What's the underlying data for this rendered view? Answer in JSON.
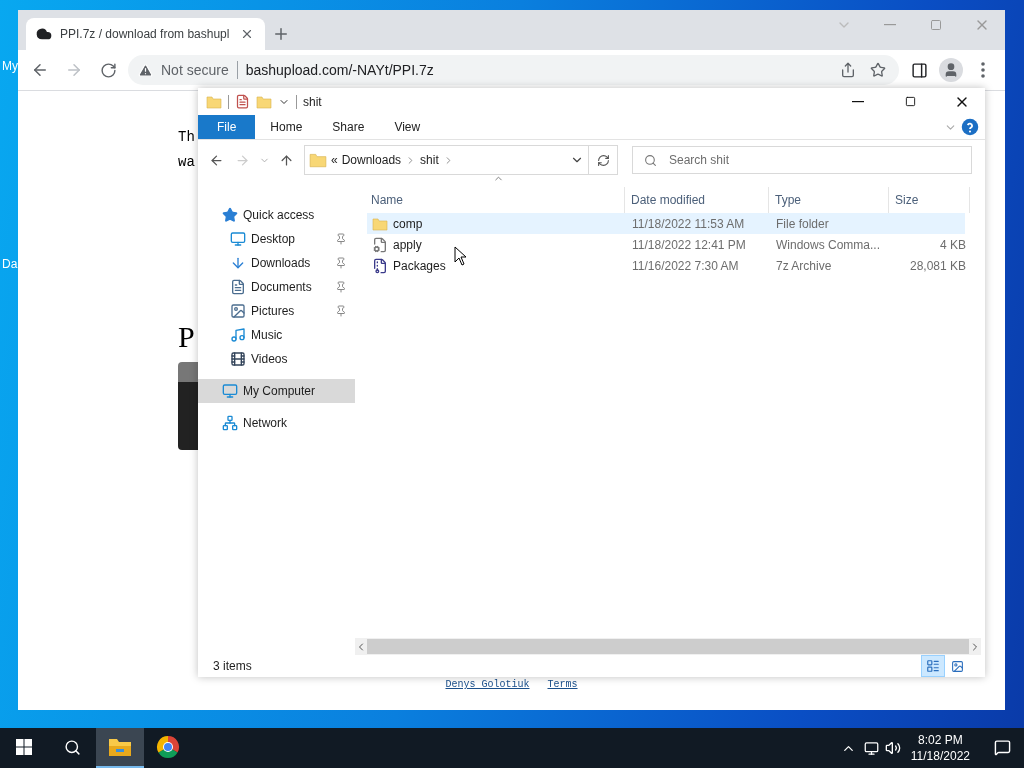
{
  "desktop": {
    "icon_labels": [
      "My",
      "Da"
    ]
  },
  "browser": {
    "tab": {
      "title": "PPI.7z / download from bashupl",
      "selected": true
    },
    "address": {
      "security": "Not secure",
      "url": "bashupload.com/-NAYt/PPI.7z"
    },
    "page": {
      "lines": [
        "Th",
        "wa"
      ],
      "heading": "P",
      "footer_links": [
        "Denys Golotiuk",
        "Terms"
      ]
    }
  },
  "explorer": {
    "title": "shit",
    "ribbon_tabs": [
      {
        "label": "File",
        "selected": true
      },
      {
        "label": "Home",
        "selected": false
      },
      {
        "label": "Share",
        "selected": false
      },
      {
        "label": "View",
        "selected": false
      }
    ],
    "breadcrumb": [
      "«",
      "Downloads",
      "shit"
    ],
    "search": {
      "placeholder": "Search shit"
    },
    "nav": [
      {
        "label": "Quick access",
        "kind": "quick",
        "selected": false,
        "children": [
          {
            "label": "Desktop",
            "kind": "desktop",
            "pinned": true,
            "selected": false
          },
          {
            "label": "Downloads",
            "kind": "downloads",
            "pinned": true,
            "selected": false
          },
          {
            "label": "Documents",
            "kind": "documents",
            "pinned": true,
            "selected": false
          },
          {
            "label": "Pictures",
            "kind": "pictures",
            "pinned": true,
            "selected": false
          },
          {
            "label": "Music",
            "kind": "music",
            "pinned": false,
            "selected": false
          },
          {
            "label": "Videos",
            "kind": "videos",
            "pinned": false,
            "selected": false
          }
        ]
      },
      {
        "label": "My Computer",
        "kind": "computer",
        "selected": true
      },
      {
        "label": "Network",
        "kind": "network",
        "selected": false
      }
    ],
    "columns": [
      "Name",
      "Date modified",
      "Type",
      "Size"
    ],
    "rows": [
      {
        "name": "comp",
        "date": "11/18/2022 11:53 AM",
        "type": "File folder",
        "kind": "folder",
        "selected": true
      },
      {
        "name": "apply",
        "date": "11/18/2022 12:41 PM",
        "type": "Windows Comma...",
        "size": "4 KB",
        "kind": "script",
        "selected": false
      },
      {
        "name": "Packages",
        "date": "11/16/2022 7:30 AM",
        "type": "7z Archive",
        "size": "28,081 KB",
        "kind": "archive",
        "selected": false
      }
    ],
    "status": "3 items"
  },
  "taskbar": {
    "apps": [
      {
        "kind": "explorer",
        "selected": true
      },
      {
        "kind": "chrome",
        "selected": false
      }
    ],
    "time": "8:02 PM",
    "date": "11/18/2022"
  }
}
